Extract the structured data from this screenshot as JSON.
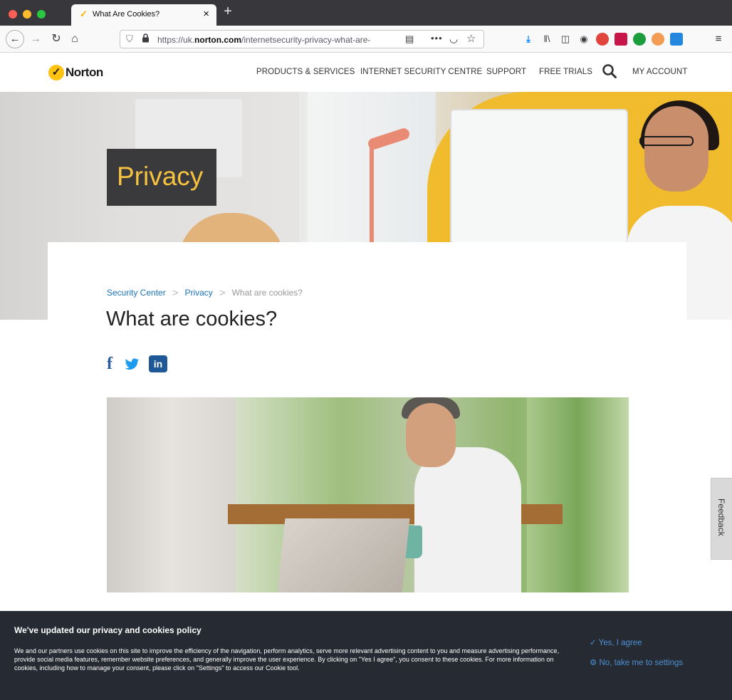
{
  "browser": {
    "tab_title": "What Are Cookies?",
    "tab_close": "×",
    "new_tab": "+",
    "url_prefix": "https://uk.",
    "url_domain": "norton.com",
    "url_path": "/internetsecurity-privacy-what-are-",
    "more_icon": "•••",
    "icons": {
      "back": "back-arrow-icon",
      "forward": "forward-arrow-icon",
      "reload": "reload-icon",
      "home": "home-icon",
      "shield": "tracking-shield-icon",
      "lock": "padlock-icon",
      "reader": "reader-view-icon",
      "pocket": "pocket-icon",
      "bookmark": "star-icon",
      "download": "download-icon",
      "library": "library-icon",
      "sidebar": "sidebar-icon",
      "account": "account-icon",
      "menu": "hamburger-menu-icon"
    }
  },
  "site": {
    "logo_text": "Norton",
    "nav": {
      "products": "PRODUCTS & SERVICES",
      "isc": "INTERNET SECURITY CENTRE",
      "support": "SUPPORT",
      "free_trials": "FREE TRIALS",
      "account": "MY ACCOUNT"
    },
    "accent_color": "#ffc20e"
  },
  "hero": {
    "badge": "Privacy"
  },
  "article": {
    "breadcrumb": [
      "Security Center",
      "Privacy",
      "What are cookies?"
    ],
    "title": "What are cookies?",
    "social": {
      "facebook": "f",
      "linkedin": "in"
    }
  },
  "feedback": {
    "label": "Feedback"
  },
  "cookie_banner": {
    "title": "We've updated our privacy and cookies policy",
    "body": "We and our partners use cookies on this site to improve the efficiency of the navigation, perform analytics, serve more relevant advertising content to you and measure advertising performance, provide social media features, remember website preferences, and generally improve the user experience. By clicking on \"Yes I agree\", you consent to these cookies. For more information on cookies, including how to manage your consent, please click on \"Settings\" to access our Cookie tool.",
    "yes_label": "✓ Yes, I agree",
    "no_label": "⚙ No, take me to settings"
  }
}
